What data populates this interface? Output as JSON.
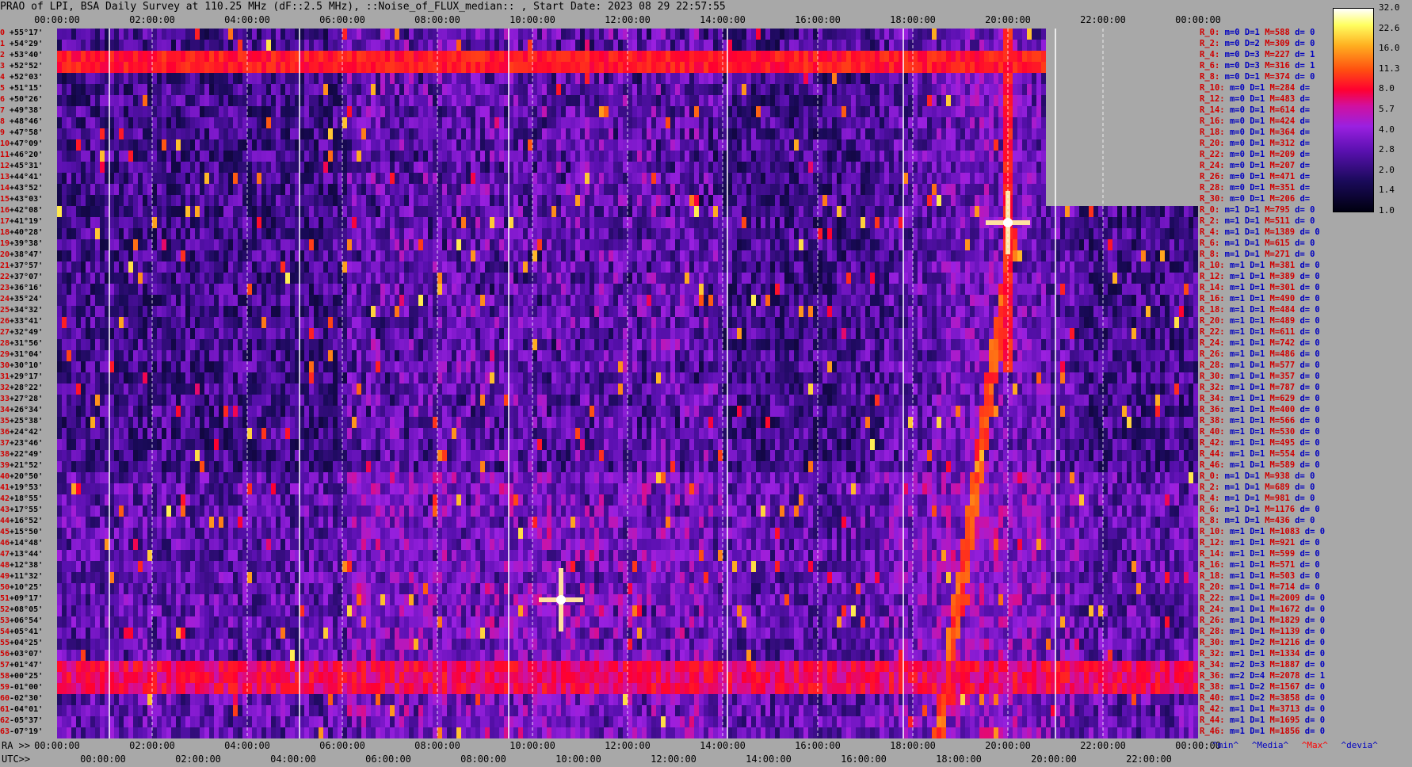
{
  "title": "PRAO of LPI, BSA Daily Survey at 110.25 MHz (dF::2.5 MHz), ::Noise_of_FLUX_median:: , Start Date: 2023 08 29 22:57:55",
  "top_axis": [
    "00:00:00",
    "02:00:00",
    "04:00:00",
    "06:00:00",
    "08:00:00",
    "10:00:00",
    "12:00:00",
    "14:00:00",
    "16:00:00",
    "18:00:00",
    "20:00:00",
    "22:00:00",
    "00:00:00"
  ],
  "bottom_axis": {
    "ra_label": "RA >>",
    "ra_ticks": [
      "00:00:00",
      "02:00:00",
      "04:00:00",
      "06:00:00",
      "08:00:00",
      "10:00:00",
      "12:00:00",
      "14:00:00",
      "16:00:00",
      "18:00:00",
      "20:00:00",
      "22:00:00",
      "00:00:00"
    ],
    "utc_label": "UTC>>",
    "utc_ticks": [
      "00:00:00",
      "02:00:00",
      "04:00:00",
      "06:00:00",
      "08:00:00",
      "10:00:00",
      "12:00:00",
      "14:00:00",
      "16:00:00",
      "18:00:00",
      "20:00:00",
      "22:00:00"
    ]
  },
  "dec_labels": [
    {
      "i": "0",
      "d": "+55°17'"
    },
    {
      "i": "1",
      "d": "+54°29'"
    },
    {
      "i": "2",
      "d": "+53°40'"
    },
    {
      "i": "3",
      "d": "+52°52'"
    },
    {
      "i": "4",
      "d": "+52°03'"
    },
    {
      "i": "5",
      "d": "+51°15'"
    },
    {
      "i": "6",
      "d": "+50°26'"
    },
    {
      "i": "7",
      "d": "+49°38'"
    },
    {
      "i": "8",
      "d": "+48°46'"
    },
    {
      "i": "9",
      "d": "+47°58'"
    },
    {
      "i": "10",
      "d": "+47°09'"
    },
    {
      "i": "11",
      "d": "+46°20'"
    },
    {
      "i": "12",
      "d": "+45°31'"
    },
    {
      "i": "13",
      "d": "+44°41'"
    },
    {
      "i": "14",
      "d": "+43°52'"
    },
    {
      "i": "15",
      "d": "+43°03'"
    },
    {
      "i": "16",
      "d": "+42°08'"
    },
    {
      "i": "17",
      "d": "+41°19'"
    },
    {
      "i": "18",
      "d": "+40°28'"
    },
    {
      "i": "19",
      "d": "+39°38'"
    },
    {
      "i": "20",
      "d": "+38°47'"
    },
    {
      "i": "21",
      "d": "+37°57'"
    },
    {
      "i": "22",
      "d": "+37°07'"
    },
    {
      "i": "23",
      "d": "+36°16'"
    },
    {
      "i": "24",
      "d": "+35°24'"
    },
    {
      "i": "25",
      "d": "+34°32'"
    },
    {
      "i": "26",
      "d": "+33°41'"
    },
    {
      "i": "27",
      "d": "+32°49'"
    },
    {
      "i": "28",
      "d": "+31°56'"
    },
    {
      "i": "29",
      "d": "+31°04'"
    },
    {
      "i": "30",
      "d": "+30°10'"
    },
    {
      "i": "31",
      "d": "+29°17'"
    },
    {
      "i": "32",
      "d": "+28°22'"
    },
    {
      "i": "33",
      "d": "+27°28'"
    },
    {
      "i": "34",
      "d": "+26°34'"
    },
    {
      "i": "35",
      "d": "+25°38'"
    },
    {
      "i": "36",
      "d": "+24°42'"
    },
    {
      "i": "37",
      "d": "+23°46'"
    },
    {
      "i": "38",
      "d": "+22°49'"
    },
    {
      "i": "39",
      "d": "+21°52'"
    },
    {
      "i": "40",
      "d": "+20°50'"
    },
    {
      "i": "41",
      "d": "+19°53'"
    },
    {
      "i": "42",
      "d": "+18°55'"
    },
    {
      "i": "43",
      "d": "+17°55'"
    },
    {
      "i": "44",
      "d": "+16°52'"
    },
    {
      "i": "45",
      "d": "+15°50'"
    },
    {
      "i": "46",
      "d": "+14°48'"
    },
    {
      "i": "47",
      "d": "+13°44'"
    },
    {
      "i": "48",
      "d": "+12°38'"
    },
    {
      "i": "49",
      "d": "+11°32'"
    },
    {
      "i": "50",
      "d": "+10°25'"
    },
    {
      "i": "51",
      "d": "+09°17'"
    },
    {
      "i": "52",
      "d": "+08°05'"
    },
    {
      "i": "53",
      "d": "+06°54'"
    },
    {
      "i": "54",
      "d": "+05°41'"
    },
    {
      "i": "55",
      "d": "+04°25'"
    },
    {
      "i": "56",
      "d": "+03°07'"
    },
    {
      "i": "57",
      "d": "+01°47'"
    },
    {
      "i": "58",
      "d": "+00°25'"
    },
    {
      "i": "59",
      "d": "-01°00'"
    },
    {
      "i": "60",
      "d": "-02°30'"
    },
    {
      "i": "61",
      "d": "-04°01'"
    },
    {
      "i": "62",
      "d": "-05°37'"
    },
    {
      "i": "63",
      "d": "-07°19'"
    }
  ],
  "stats": [
    {
      "r": "R_0:",
      "m": "m=0",
      "d": "D=1",
      "mx": "M=588",
      "dv": "d= 0"
    },
    {
      "r": "R_2:",
      "m": "m=0",
      "d": "D=2",
      "mx": "M=309",
      "dv": "d= 0"
    },
    {
      "r": "R_4:",
      "m": "m=0",
      "d": "D=3",
      "mx": "M=227",
      "dv": "d= 1"
    },
    {
      "r": "R_6:",
      "m": "m=0",
      "d": "D=3",
      "mx": "M=316",
      "dv": "d= 1"
    },
    {
      "r": "R_8:",
      "m": "m=0",
      "d": "D=1",
      "mx": "M=374",
      "dv": "d= 0"
    },
    {
      "r": "R_10:",
      "m": "m=0",
      "d": "D=1",
      "mx": "M=284",
      "dv": "d="
    },
    {
      "r": "R_12:",
      "m": "m=0",
      "d": "D=1",
      "mx": "M=483",
      "dv": "d="
    },
    {
      "r": "R_14:",
      "m": "m=0",
      "d": "D=1",
      "mx": "M=614",
      "dv": "d="
    },
    {
      "r": "R_16:",
      "m": "m=0",
      "d": "D=1",
      "mx": "M=424",
      "dv": "d="
    },
    {
      "r": "R_18:",
      "m": "m=0",
      "d": "D=1",
      "mx": "M=364",
      "dv": "d="
    },
    {
      "r": "R_20:",
      "m": "m=0",
      "d": "D=1",
      "mx": "M=312",
      "dv": "d="
    },
    {
      "r": "R_22:",
      "m": "m=0",
      "d": "D=1",
      "mx": "M=209",
      "dv": "d="
    },
    {
      "r": "R_24:",
      "m": "m=0",
      "d": "D=1",
      "mx": "M=207",
      "dv": "d="
    },
    {
      "r": "R_26:",
      "m": "m=0",
      "d": "D=1",
      "mx": "M=471",
      "dv": "d="
    },
    {
      "r": "R_28:",
      "m": "m=0",
      "d": "D=1",
      "mx": "M=351",
      "dv": "d="
    },
    {
      "r": "R_30:",
      "m": "m=0",
      "d": "D=1",
      "mx": "M=206",
      "dv": "d="
    },
    {
      "r": "R_0:",
      "m": "m=1",
      "d": "D=1",
      "mx": "M=795",
      "dv": "d= 0"
    },
    {
      "r": "R_2:",
      "m": "m=1",
      "d": "D=1",
      "mx": "M=511",
      "dv": "d= 0"
    },
    {
      "r": "R_4:",
      "m": "m=1",
      "d": "D=1",
      "mx": "M=1389",
      "dv": "d= 0"
    },
    {
      "r": "R_6:",
      "m": "m=1",
      "d": "D=1",
      "mx": "M=615",
      "dv": "d= 0"
    },
    {
      "r": "R_8:",
      "m": "m=1",
      "d": "D=1",
      "mx": "M=271",
      "dv": "d= 0"
    },
    {
      "r": "R_10:",
      "m": "m=1",
      "d": "D=1",
      "mx": "M=381",
      "dv": "d= 0"
    },
    {
      "r": "R_12:",
      "m": "m=1",
      "d": "D=1",
      "mx": "M=389",
      "dv": "d= 0"
    },
    {
      "r": "R_14:",
      "m": "m=1",
      "d": "D=1",
      "mx": "M=301",
      "dv": "d= 0"
    },
    {
      "r": "R_16:",
      "m": "m=1",
      "d": "D=1",
      "mx": "M=490",
      "dv": "d= 0"
    },
    {
      "r": "R_18:",
      "m": "m=1",
      "d": "D=1",
      "mx": "M=484",
      "dv": "d= 0"
    },
    {
      "r": "R_20:",
      "m": "m=1",
      "d": "D=1",
      "mx": "M=489",
      "dv": "d= 0"
    },
    {
      "r": "R_22:",
      "m": "m=1",
      "d": "D=1",
      "mx": "M=611",
      "dv": "d= 0"
    },
    {
      "r": "R_24:",
      "m": "m=1",
      "d": "D=1",
      "mx": "M=742",
      "dv": "d= 0"
    },
    {
      "r": "R_26:",
      "m": "m=1",
      "d": "D=1",
      "mx": "M=486",
      "dv": "d= 0"
    },
    {
      "r": "R_28:",
      "m": "m=1",
      "d": "D=1",
      "mx": "M=577",
      "dv": "d= 0"
    },
    {
      "r": "R_30:",
      "m": "m=1",
      "d": "D=1",
      "mx": "M=357",
      "dv": "d= 0"
    },
    {
      "r": "R_32:",
      "m": "m=1",
      "d": "D=1",
      "mx": "M=787",
      "dv": "d= 0"
    },
    {
      "r": "R_34:",
      "m": "m=1",
      "d": "D=1",
      "mx": "M=629",
      "dv": "d= 0"
    },
    {
      "r": "R_36:",
      "m": "m=1",
      "d": "D=1",
      "mx": "M=400",
      "dv": "d= 0"
    },
    {
      "r": "R_38:",
      "m": "m=1",
      "d": "D=1",
      "mx": "M=566",
      "dv": "d= 0"
    },
    {
      "r": "R_40:",
      "m": "m=1",
      "d": "D=1",
      "mx": "M=530",
      "dv": "d= 0"
    },
    {
      "r": "R_42:",
      "m": "m=1",
      "d": "D=1",
      "mx": "M=495",
      "dv": "d= 0"
    },
    {
      "r": "R_44:",
      "m": "m=1",
      "d": "D=1",
      "mx": "M=554",
      "dv": "d= 0"
    },
    {
      "r": "R_46:",
      "m": "m=1",
      "d": "D=1",
      "mx": "M=589",
      "dv": "d= 0"
    },
    {
      "r": "R_0:",
      "m": "m=1",
      "d": "D=1",
      "mx": "M=938",
      "dv": "d= 0"
    },
    {
      "r": "R_2:",
      "m": "m=1",
      "d": "D=1",
      "mx": "M=689",
      "dv": "d= 0"
    },
    {
      "r": "R_4:",
      "m": "m=1",
      "d": "D=1",
      "mx": "M=981",
      "dv": "d= 0"
    },
    {
      "r": "R_6:",
      "m": "m=1",
      "d": "D=1",
      "mx": "M=1176",
      "dv": "d= 0"
    },
    {
      "r": "R_8:",
      "m": "m=1",
      "d": "D=1",
      "mx": "M=436",
      "dv": "d= 0"
    },
    {
      "r": "R_10:",
      "m": "m=1",
      "d": "D=1",
      "mx": "M=1083",
      "dv": "d= 0"
    },
    {
      "r": "R_12:",
      "m": "m=1",
      "d": "D=1",
      "mx": "M=921",
      "dv": "d= 0"
    },
    {
      "r": "R_14:",
      "m": "m=1",
      "d": "D=1",
      "mx": "M=599",
      "dv": "d= 0"
    },
    {
      "r": "R_16:",
      "m": "m=1",
      "d": "D=1",
      "mx": "M=571",
      "dv": "d= 0"
    },
    {
      "r": "R_18:",
      "m": "m=1",
      "d": "D=1",
      "mx": "M=503",
      "dv": "d= 0"
    },
    {
      "r": "R_20:",
      "m": "m=1",
      "d": "D=1",
      "mx": "M=714",
      "dv": "d= 0"
    },
    {
      "r": "R_22:",
      "m": "m=1",
      "d": "D=1",
      "mx": "M=2009",
      "dv": "d= 0"
    },
    {
      "r": "R_24:",
      "m": "m=1",
      "d": "D=1",
      "mx": "M=1672",
      "dv": "d= 0"
    },
    {
      "r": "R_26:",
      "m": "m=1",
      "d": "D=1",
      "mx": "M=1829",
      "dv": "d= 0"
    },
    {
      "r": "R_28:",
      "m": "m=1",
      "d": "D=1",
      "mx": "M=1139",
      "dv": "d= 0"
    },
    {
      "r": "R_30:",
      "m": "m=1",
      "d": "D=2",
      "mx": "M=1216",
      "dv": "d= 0"
    },
    {
      "r": "R_32:",
      "m": "m=1",
      "d": "D=1",
      "mx": "M=1334",
      "dv": "d= 0"
    },
    {
      "r": "R_34:",
      "m": "m=2",
      "d": "D=3",
      "mx": "M=1887",
      "dv": "d= 0"
    },
    {
      "r": "R_36:",
      "m": "m=2",
      "d": "D=4",
      "mx": "M=2078",
      "dv": "d= 1"
    },
    {
      "r": "R_38:",
      "m": "m=1",
      "d": "D=2",
      "mx": "M=1567",
      "dv": "d= 0"
    },
    {
      "r": "R_40:",
      "m": "m=1",
      "d": "D=2",
      "mx": "M=3858",
      "dv": "d= 0"
    },
    {
      "r": "R_42:",
      "m": "m=1",
      "d": "D=1",
      "mx": "M=3713",
      "dv": "d= 0"
    },
    {
      "r": "R_44:",
      "m": "m=1",
      "d": "D=1",
      "mx": "M=1695",
      "dv": "d= 0"
    },
    {
      "r": "R_46:",
      "m": "m=1",
      "d": "D=1",
      "mx": "M=1856",
      "dv": "d= 0"
    }
  ],
  "legend": {
    "min": "^min^",
    "median": "^Media^",
    "max": "^Max^",
    "devia": "^devia^"
  },
  "colors": {
    "max": "#ff0000",
    "min": "#0000c0",
    "background": "#a8a8a8"
  },
  "chart_data": {
    "type": "heatmap",
    "title": "PRAO of LPI, BSA Daily Survey at 110.25 MHz (dF::2.5 MHz), ::Noise_of_FLUX_median:: , Start Date: 2023 08 29 22:57:55",
    "x_axis": "RA 00:00:00 to 00:00:00 (24h), UTC 00:00:00 to 22:00:00",
    "y_axis": "Declination rows 0..63 (+55°17' to -07°19')",
    "colorbar": {
      "ticks": [
        "32.0",
        "22.6",
        "16.0",
        "11.3",
        "8.0",
        "5.7",
        "4.0",
        "2.8",
        "2.0",
        "1.4",
        "1.0"
      ],
      "scale": "log"
    },
    "features": [
      {
        "name": "strong horizontal band",
        "rows": [
          2,
          3
        ]
      },
      {
        "name": "horizontal band",
        "rows": [
          57,
          59
        ]
      },
      {
        "name": "bright source",
        "ra_h": 10.6,
        "row": 51
      },
      {
        "name": "bright source",
        "ra_h": 20.0,
        "row": 17
      },
      {
        "name": "diagonal drift",
        "ra_h_range": [
          18.5,
          20.1
        ]
      },
      {
        "name": "missing data region",
        "ra_h_range": [
          20.8,
          24.0
        ],
        "rows": [
          0,
          15
        ]
      }
    ]
  }
}
